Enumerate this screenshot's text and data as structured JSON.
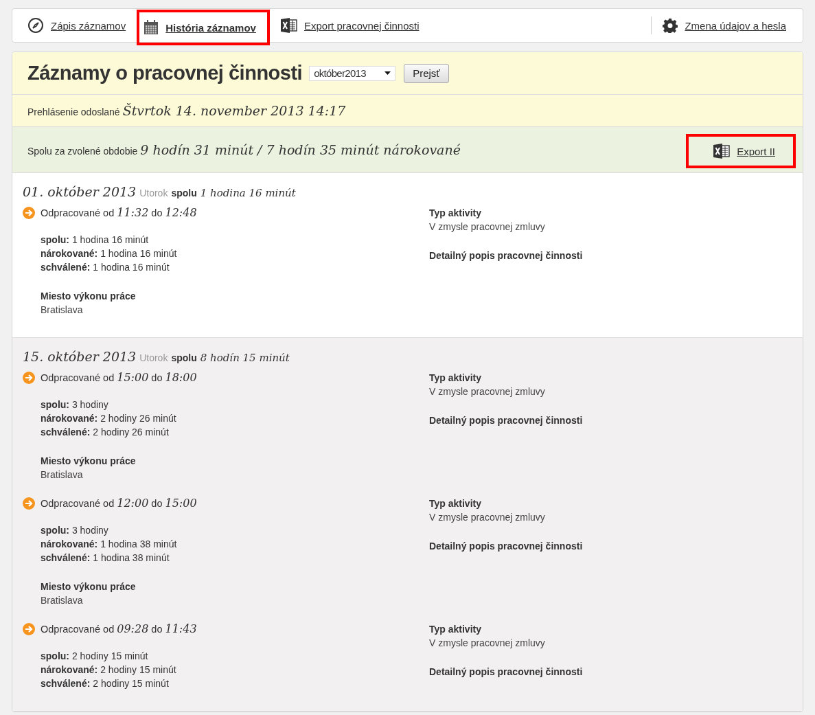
{
  "nav": {
    "items": [
      {
        "label": "Zápis záznamov",
        "kind": "compass",
        "highlighted": false
      },
      {
        "label": "História záznamov",
        "kind": "calendar",
        "highlighted": true
      },
      {
        "label": "Export pracovnej činnosti",
        "kind": "excel",
        "highlighted": false
      }
    ],
    "settings": {
      "label": "Zmena údajov a hesla",
      "kind": "gear",
      "highlighted": false
    }
  },
  "header": {
    "title": "Záznamy o pracovnej činnosti",
    "month_select": "október2013",
    "go_button": "Prejsť"
  },
  "submitted": {
    "label": "Prehlásenie odoslané",
    "value": "Štvrtok 14. november 2013 14:17"
  },
  "total": {
    "label": "Spolu za zvolené obdobie",
    "value": "9 hodín 31 minút / 7 hodín 35 minút nárokované",
    "export": {
      "label": "Export II",
      "highlighted": true
    }
  },
  "days": [
    {
      "date": "01. október 2013",
      "weekday": "Utorok",
      "total_label": "spolu",
      "total_value": "1 hodina 16 minút",
      "shaded": false,
      "entries": [
        {
          "from_label": "Odpracované od",
          "from": "11:32",
          "to_label": "do",
          "to": "12:48",
          "stats": [
            {
              "label": "spolu:",
              "value": "1 hodina 16 minút"
            },
            {
              "label": "nárokované:",
              "value": "1 hodina 16 minút"
            },
            {
              "label": "schválené:",
              "value": "1 hodina 16 minút"
            }
          ],
          "place_label": "Miesto výkonu práce",
          "place": "Bratislava",
          "activity_label": "Typ aktivity",
          "activity": "V zmysle pracovnej zmluvy",
          "description_label": "Detailný popis pracovnej činnosti"
        }
      ]
    },
    {
      "date": "15. október 2013",
      "weekday": "Utorok",
      "total_label": "spolu",
      "total_value": "8 hodín 15 minút",
      "shaded": true,
      "entries": [
        {
          "from_label": "Odpracované od",
          "from": "15:00",
          "to_label": "do",
          "to": "18:00",
          "stats": [
            {
              "label": "spolu:",
              "value": "3 hodiny"
            },
            {
              "label": "nárokované:",
              "value": "2 hodiny 26 minút"
            },
            {
              "label": "schválené:",
              "value": "2 hodiny 26 minút"
            }
          ],
          "place_label": "Miesto výkonu práce",
          "place": "Bratislava",
          "activity_label": "Typ aktivity",
          "activity": "V zmysle pracovnej zmluvy",
          "description_label": "Detailný popis pracovnej činnosti"
        },
        {
          "from_label": "Odpracované od",
          "from": "12:00",
          "to_label": "do",
          "to": "15:00",
          "stats": [
            {
              "label": "spolu:",
              "value": "3 hodiny"
            },
            {
              "label": "nárokované:",
              "value": "1 hodina 38 minút"
            },
            {
              "label": "schválené:",
              "value": "1 hodina 38 minút"
            }
          ],
          "place_label": "Miesto výkonu práce",
          "place": "Bratislava",
          "activity_label": "Typ aktivity",
          "activity": "V zmysle pracovnej zmluvy",
          "description_label": "Detailný popis pracovnej činnosti"
        },
        {
          "from_label": "Odpracované od",
          "from": "09:28",
          "to_label": "do",
          "to": "11:43",
          "stats": [
            {
              "label": "spolu:",
              "value": "2 hodiny 15 minút"
            },
            {
              "label": "nárokované:",
              "value": "2 hodiny 15 minút"
            },
            {
              "label": "schválené:",
              "value": "2 hodiny 15 minút"
            }
          ],
          "activity_label": "Typ aktivity",
          "activity": "V zmysle pracovnej zmluvy",
          "description_label": "Detailný popis pracovnej činnosti"
        }
      ]
    }
  ]
}
